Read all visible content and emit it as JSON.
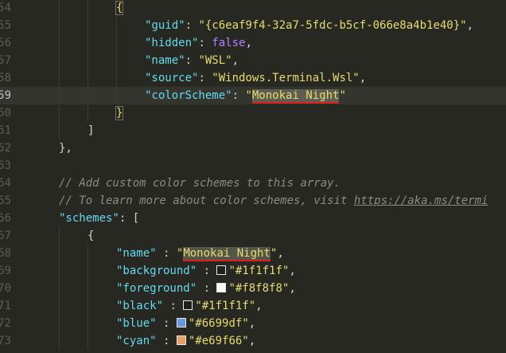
{
  "editor": {
    "theme_colors": {
      "background": "#272822",
      "string": "#e6db74",
      "key": "#66d9ef",
      "boolean": "#ae81ff",
      "comment": "#8b8b80",
      "spellcheck_underline": "#e21f1f"
    },
    "lines": [
      {
        "gutter": "54",
        "current": false,
        "indent": 2,
        "tokens": [
          {
            "t": "{",
            "c": "bracket-match"
          }
        ]
      },
      {
        "gutter": "55",
        "current": false,
        "indent": 3,
        "tokens": [
          {
            "t": "\"guid\"",
            "c": "key"
          },
          {
            "t": ": ",
            "c": "punct"
          },
          {
            "t": "\"{c6eaf9f4-32a7-5fdc-b5cf-066e8a4b1e40}\"",
            "c": "str"
          },
          {
            "t": ",",
            "c": "punct"
          }
        ]
      },
      {
        "gutter": "56",
        "current": false,
        "indent": 3,
        "tokens": [
          {
            "t": "\"hidden\"",
            "c": "key"
          },
          {
            "t": ": ",
            "c": "punct"
          },
          {
            "t": "false",
            "c": "bool"
          },
          {
            "t": ",",
            "c": "punct"
          }
        ]
      },
      {
        "gutter": "57",
        "current": false,
        "indent": 3,
        "tokens": [
          {
            "t": "\"name\"",
            "c": "key"
          },
          {
            "t": ": ",
            "c": "punct"
          },
          {
            "t": "\"WSL\"",
            "c": "str"
          },
          {
            "t": ",",
            "c": "punct"
          }
        ]
      },
      {
        "gutter": "58",
        "current": false,
        "indent": 3,
        "tokens": [
          {
            "t": "\"source\"",
            "c": "key"
          },
          {
            "t": ": ",
            "c": "punct"
          },
          {
            "t": "\"Windows.Terminal.Wsl\"",
            "c": "str"
          },
          {
            "t": ",",
            "c": "punct"
          }
        ]
      },
      {
        "gutter": "59",
        "current": true,
        "indent": 3,
        "tokens": [
          {
            "t": "\"colorScheme\"",
            "c": "key"
          },
          {
            "t": ": ",
            "c": "punct"
          },
          {
            "t": "\"",
            "c": "str"
          },
          {
            "t": "Monokai Night",
            "c": "spell"
          },
          {
            "t": "\"",
            "c": "str"
          }
        ]
      },
      {
        "gutter": "60",
        "current": false,
        "indent": 2,
        "tokens": [
          {
            "t": "}",
            "c": "bracket-match"
          }
        ]
      },
      {
        "gutter": "61",
        "current": false,
        "indent": 1,
        "tokens": [
          {
            "t": "]",
            "c": "punct"
          }
        ]
      },
      {
        "gutter": "62",
        "current": false,
        "indent": 0,
        "tokens": [
          {
            "t": "},",
            "c": "punct"
          }
        ]
      },
      {
        "gutter": "63",
        "current": false,
        "indent": 0,
        "tokens": []
      },
      {
        "gutter": "64",
        "current": false,
        "indent": 0,
        "tokens": [
          {
            "t": "// Add custom color schemes to this array.",
            "c": "comment"
          }
        ]
      },
      {
        "gutter": "65",
        "current": false,
        "indent": 0,
        "tokens": [
          {
            "t": "// To learn more about color schemes, visit ",
            "c": "comment"
          },
          {
            "t": "https://aka.ms/termi",
            "c": "url"
          }
        ]
      },
      {
        "gutter": "66",
        "current": false,
        "indent": 0,
        "tokens": [
          {
            "t": "\"schemes\"",
            "c": "key"
          },
          {
            "t": ": [",
            "c": "punct"
          }
        ]
      },
      {
        "gutter": "67",
        "current": false,
        "indent": 1,
        "tokens": [
          {
            "t": "{",
            "c": "punct"
          }
        ]
      },
      {
        "gutter": "68",
        "current": false,
        "indent": 2,
        "tokens": [
          {
            "t": "\"name\"",
            "c": "key"
          },
          {
            "t": " : ",
            "c": "punct"
          },
          {
            "t": "\"",
            "c": "str"
          },
          {
            "t": "Monokai Night",
            "c": "spell"
          },
          {
            "t": "\"",
            "c": "str"
          },
          {
            "t": ",",
            "c": "punct"
          }
        ]
      },
      {
        "gutter": "69",
        "current": false,
        "indent": 2,
        "tokens": [
          {
            "t": "\"background\"",
            "c": "key"
          },
          {
            "t": " : ",
            "c": "punct"
          },
          {
            "swatch": "#1f1f1f"
          },
          {
            "t": "\"#1f1f1f\"",
            "c": "str"
          },
          {
            "t": ",",
            "c": "punct"
          }
        ]
      },
      {
        "gutter": "70",
        "current": false,
        "indent": 2,
        "tokens": [
          {
            "t": "\"foreground\"",
            "c": "key"
          },
          {
            "t": " : ",
            "c": "punct"
          },
          {
            "swatch": "#f8f8f8"
          },
          {
            "t": "\"#f8f8f8\"",
            "c": "str"
          },
          {
            "t": ",",
            "c": "punct"
          }
        ]
      },
      {
        "gutter": "71",
        "current": false,
        "indent": 2,
        "tokens": [
          {
            "t": "\"black\"",
            "c": "key"
          },
          {
            "t": " : ",
            "c": "punct"
          },
          {
            "swatch": "#1f1f1f"
          },
          {
            "t": "\"#1f1f1f\"",
            "c": "str"
          },
          {
            "t": ",",
            "c": "punct"
          }
        ]
      },
      {
        "gutter": "72",
        "current": false,
        "indent": 2,
        "tokens": [
          {
            "t": "\"blue\"",
            "c": "key"
          },
          {
            "t": " : ",
            "c": "punct"
          },
          {
            "swatch": "#6699df"
          },
          {
            "t": "\"#6699df\"",
            "c": "str"
          },
          {
            "t": ",",
            "c": "punct"
          }
        ]
      },
      {
        "gutter": "73",
        "current": false,
        "indent": 2,
        "tokens": [
          {
            "t": "\"cyan\"",
            "c": "key"
          },
          {
            "t": " : ",
            "c": "punct"
          },
          {
            "swatch": "#e69f66"
          },
          {
            "t": "\"#e69f66\"",
            "c": "str"
          },
          {
            "t": ",",
            "c": "punct"
          }
        ]
      }
    ]
  }
}
